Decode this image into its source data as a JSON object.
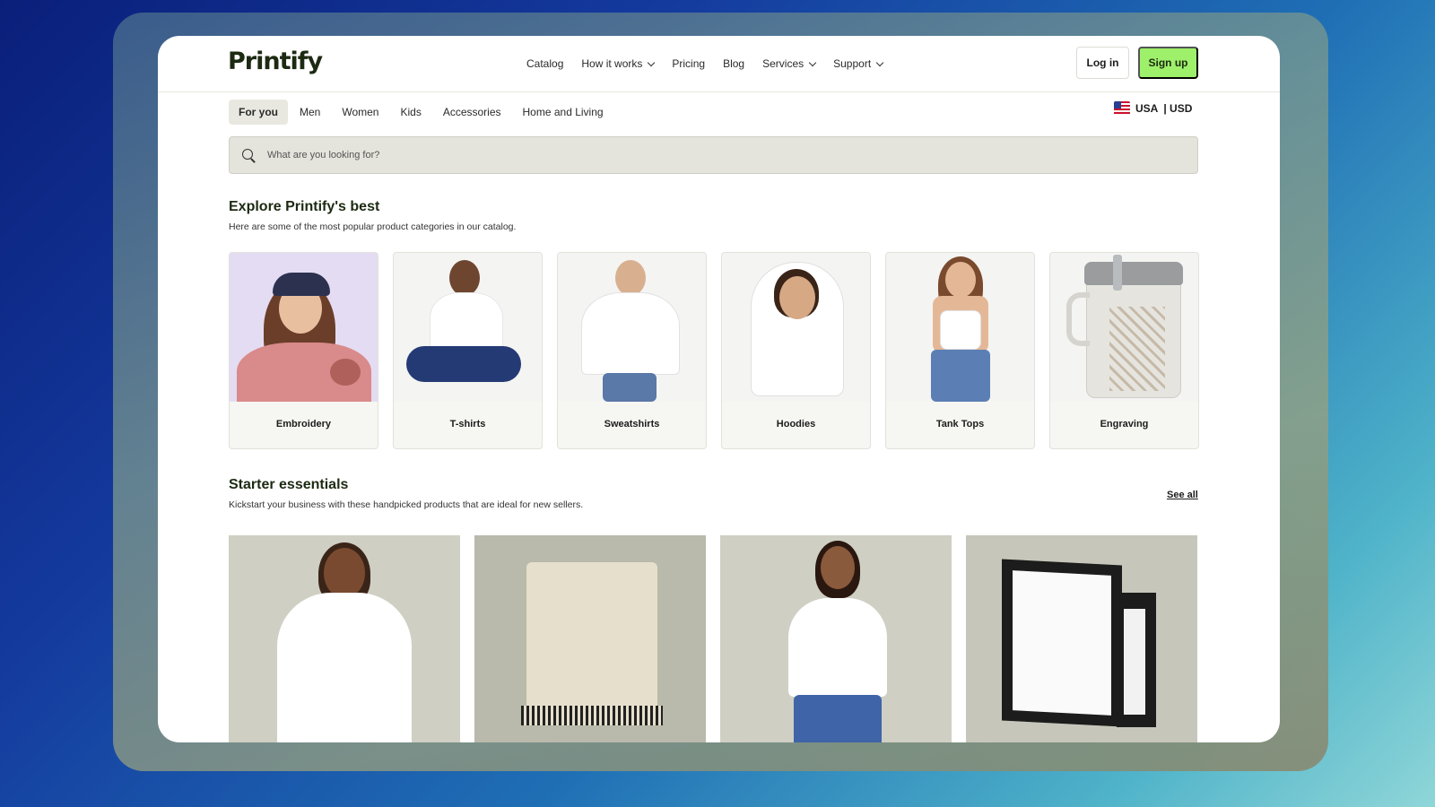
{
  "brand": {
    "logo": "Printify"
  },
  "nav": {
    "items": [
      {
        "label": "Catalog",
        "dropdown": false
      },
      {
        "label": "How it works",
        "dropdown": true
      },
      {
        "label": "Pricing",
        "dropdown": false
      },
      {
        "label": "Blog",
        "dropdown": false
      },
      {
        "label": "Services",
        "dropdown": true
      },
      {
        "label": "Support",
        "dropdown": true
      }
    ],
    "login": "Log in",
    "signup": "Sign up"
  },
  "category_tabs": {
    "items": [
      "For you",
      "Men",
      "Women",
      "Kids",
      "Accessories",
      "Home and Living"
    ],
    "active": "For you"
  },
  "region": {
    "country": "USA",
    "currency": "| USD",
    "flag_icon": "us-flag-icon"
  },
  "search": {
    "placeholder": "What are you looking for?"
  },
  "explore": {
    "title": "Explore Printify's best",
    "subtitle": "Here are some of the most popular product categories in our catalog.",
    "categories": [
      {
        "label": "Embroidery",
        "bg": "#e4dcf2"
      },
      {
        "label": "T-shirts",
        "bg": "#f4f4f2"
      },
      {
        "label": "Sweatshirts",
        "bg": "#f4f4f2"
      },
      {
        "label": "Hoodies",
        "bg": "#f4f4f2"
      },
      {
        "label": "Tank Tops",
        "bg": "#f4f4f2"
      },
      {
        "label": "Engraving",
        "bg": "#f4f4f2"
      }
    ]
  },
  "starter": {
    "title": "Starter essentials",
    "subtitle": "Kickstart your business with these handpicked products that are ideal for new sellers.",
    "see_all": "See all"
  },
  "colors": {
    "accent": "#9ef06a",
    "brand_text": "#1c2a12"
  }
}
